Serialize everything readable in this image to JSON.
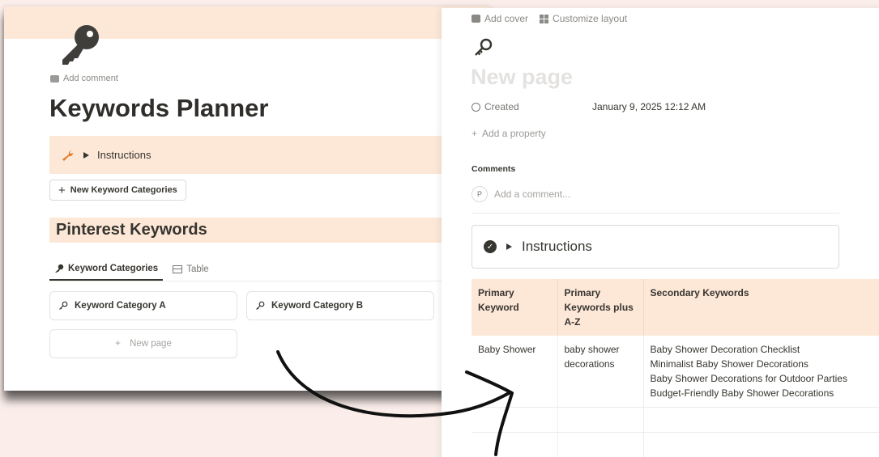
{
  "left_window": {
    "add_comment": "Add comment",
    "title": "Keywords Planner",
    "callout_label": "Instructions",
    "new_categories_button": "New Keyword Categories",
    "section_heading": "Pinterest Keywords",
    "tabs": [
      {
        "label": "Keyword Categories",
        "icon": "key-icon",
        "active": true
      },
      {
        "label": "Table",
        "icon": "table-icon",
        "active": false
      }
    ],
    "cards": [
      "Keyword Category A",
      "Keyword Category B"
    ],
    "new_page": "New page",
    "colors": {
      "accent_bg": "#fde8d8",
      "wrench": "#e07b28"
    }
  },
  "right_window": {
    "add_cover": "Add cover",
    "customize_layout": "Customize layout",
    "page_title_placeholder": "New page",
    "property_name": "Created",
    "property_value": "January 9, 2025 12:12 AM",
    "add_property": "Add a property",
    "comments_heading": "Comments",
    "avatar_initial": "P",
    "comment_placeholder": "Add a comment...",
    "instructions_label": "Instructions",
    "table": {
      "headers": [
        "Primary Keyword",
        "Primary Keywords plus A-Z",
        "Secondary Keywords"
      ],
      "rows": [
        {
          "primary": "Baby Shower",
          "plus": "baby shower decorations",
          "secondary": [
            "Baby Shower Decoration Checklist",
            "Minimalist Baby Shower Decorations",
            "Baby Shower Decorations for Outdoor Parties",
            "Budget-Friendly Baby Shower Decorations"
          ]
        }
      ]
    }
  }
}
